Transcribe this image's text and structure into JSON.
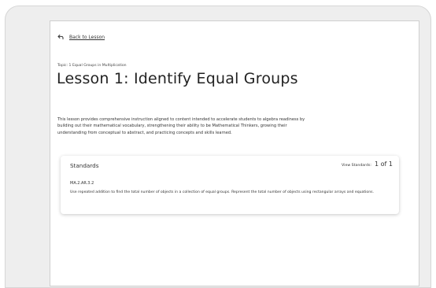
{
  "nav": {
    "back_label": "Back to Lesson"
  },
  "lesson": {
    "topic": "Topic: 1 Equal Groups in Multiplication",
    "title": "Lesson 1: Identify Equal Groups",
    "description": "This lesson provides comprehensive instruction aligned to content intended to accelerate students to algebra readiness by building out their mathematical vocabulary, strengthening their ability to be Mathematical Thinkers, growing their understanding from conceptual to abstract, and practicing concepts and skills learned."
  },
  "standards": {
    "heading": "Standards",
    "view_label": "View Standards:",
    "view_count": "1 of 1",
    "items": [
      {
        "code": "MA.2.AR.3.2",
        "description": "Use repeated addition to find the total number of objects in a collection of equal groups. Represent the total number of objects using rectangular arrays and equations."
      }
    ]
  },
  "icons": {
    "back": "back-arrow-icon"
  }
}
